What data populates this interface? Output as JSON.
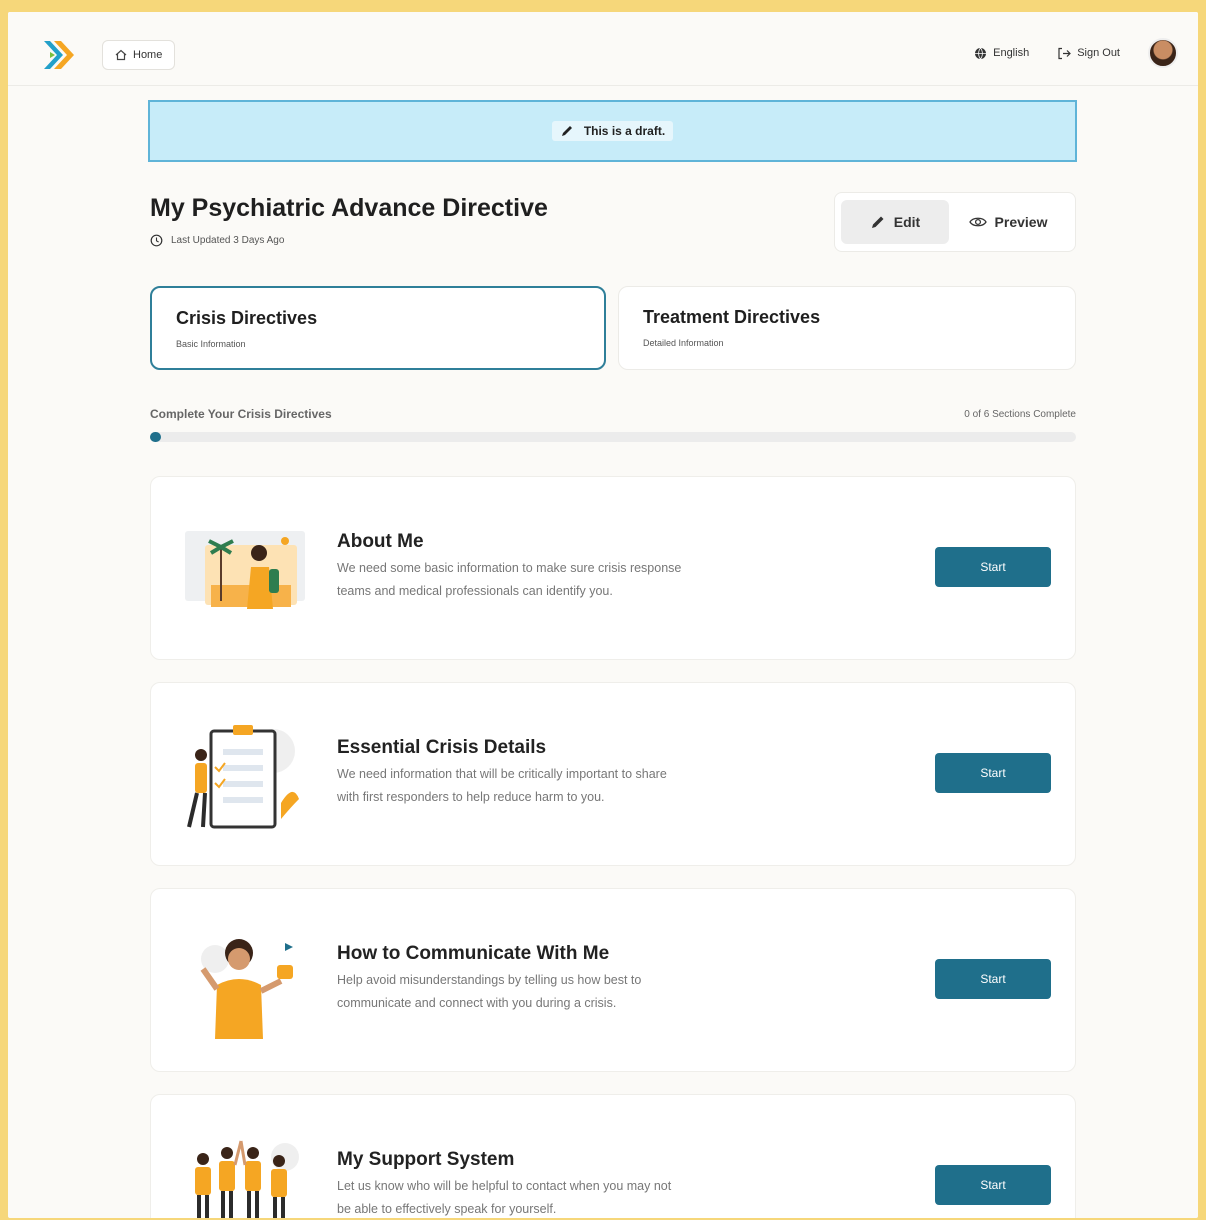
{
  "nav": {
    "home_label": "Home",
    "language_label": "English",
    "signout_label": "Sign Out"
  },
  "banner": {
    "text": "This is a draft."
  },
  "header": {
    "title": "My Psychiatric Advance Directive",
    "updated": "Last Updated 3 Days Ago",
    "edit_label": "Edit",
    "preview_label": "Preview"
  },
  "tabs": [
    {
      "title": "Crisis Directives",
      "subtitle": "Basic Information"
    },
    {
      "title": "Treatment Directives",
      "subtitle": "Detailed Information"
    }
  ],
  "progress": {
    "label": "Complete Your Crisis Directives",
    "count_text": "0 of 6 Sections Complete",
    "fraction": 0.012
  },
  "sections": [
    {
      "title": "About Me",
      "desc_line1": "We need some basic information to make sure crisis response",
      "desc_line2": "teams and medical professionals can identify you.",
      "button": "Start"
    },
    {
      "title": "Essential Crisis Details",
      "desc_line1": "We need information that will be critically important to share",
      "desc_line2": "with first responders to help reduce harm to you.",
      "button": "Start"
    },
    {
      "title": "How to Communicate With Me",
      "desc_line1": "Help avoid misunderstandings by telling us how best to",
      "desc_line2": "communicate and connect with you during a crisis.",
      "button": "Start"
    },
    {
      "title": "My Support System",
      "desc_line1": "Let us know who will be helpful to contact when you may not",
      "desc_line2": "be able to effectively speak for yourself.",
      "button": "Start"
    }
  ],
  "colors": {
    "accent": "#1f6f8b",
    "illustration_yellow": "#f5a623",
    "banner_bg": "#c7ecf9",
    "frame_border": "#f6d77a"
  },
  "icons": [
    "logo-icon",
    "home-icon",
    "globe-icon",
    "sign-out-icon",
    "pencil-icon",
    "clock-icon",
    "eye-icon"
  ]
}
